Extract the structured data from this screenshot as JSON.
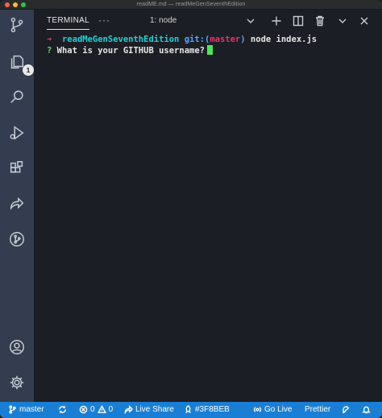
{
  "window": {
    "title": "readME.md — readMeGenSeventhEdition"
  },
  "activity_bar": {
    "icons": [
      "source-control-icon",
      "explorer-icon",
      "search-icon",
      "run-debug-icon",
      "extensions-icon",
      "live-share-icon",
      "git-graph-icon",
      "account-icon",
      "settings-gear-icon"
    ],
    "explorer_badge": "1"
  },
  "panel": {
    "tab_label": "TERMINAL",
    "more_label": "···",
    "terminal_select": "1: node"
  },
  "terminal": {
    "prompt_arrow": "➜",
    "directory": "readMeGenSeventhEdition",
    "git_prefix": "git:(",
    "branch": "master",
    "git_suffix": ")",
    "command": "node index.js",
    "question_mark": "?",
    "question": "What is your GITHUB username?"
  },
  "status_bar": {
    "branch": "master",
    "errors": "0",
    "warnings": "0",
    "live_share": "Live Share",
    "color_label": "#3F8BEB",
    "go_live": "Go Live",
    "prettier": "Prettier"
  },
  "colors": {
    "status_bar": "#1a7fd4",
    "activity_bar": "#333d4f",
    "terminal_bg": "#1b1e24",
    "prompt_arrow": "#e8336b",
    "directory": "#20d0d8",
    "git": "#5aa7ff",
    "cursor": "#49e85a"
  }
}
